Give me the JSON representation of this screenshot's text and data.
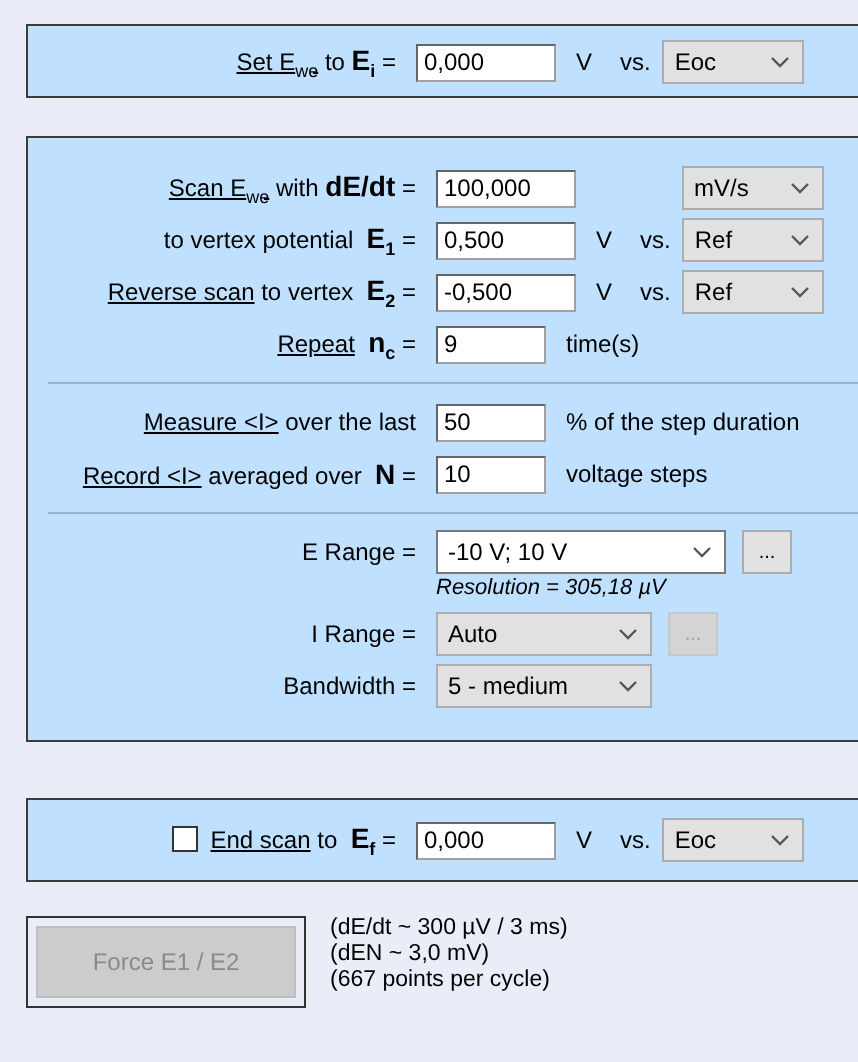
{
  "initial": {
    "kind": "potential",
    "link": "Set E$_{we}$",
    "label": " to **E**$_{i}$ =",
    "value": "0,000",
    "unit": "V",
    "vs": "vs.",
    "dropdown": "Eoc"
  },
  "scan": {
    "groups": [
      [
        {
          "kind": "rate",
          "link": "Scan E$_{we}$",
          "label": " with **dE/dt** =",
          "value": "100,000",
          "dropdown": "mV/s"
        },
        {
          "kind": "potential",
          "label": "to vertex potential  **E**$_{1}$ =",
          "value": "0,500",
          "unit": "V",
          "vs": "vs.",
          "dropdown": "Ref"
        },
        {
          "kind": "potential",
          "link": "Reverse scan",
          "label": " to vertex  **E**$_{2}$ =",
          "value": "-0,500",
          "unit": "V",
          "vs": "vs.",
          "dropdown": "Ref"
        },
        {
          "kind": "count",
          "link": "Repeat",
          "label": "  **n**$_{c}$ =",
          "value": "9",
          "unit": "time(s)"
        }
      ],
      [
        {
          "kind": "count",
          "link": "Measure <I>",
          "label": " over the last",
          "value": "50",
          "unit": "% of the step duration"
        },
        {
          "kind": "count",
          "link": "Record <I>",
          "label": " averaged over  **N** =",
          "value": "10",
          "unit": "voltage steps"
        }
      ],
      [
        {
          "kind": "select",
          "label": "E Range =",
          "dropdown": "-10 V; 10 V",
          "editable": true,
          "more": "...",
          "more_disabled": false,
          "note": "Resolution = 305,18 µV"
        },
        {
          "kind": "select",
          "label": "I Range =",
          "dropdown": "Auto",
          "editable": false,
          "more": "...",
          "more_disabled": true
        },
        {
          "kind": "select",
          "label": "Bandwidth =",
          "dropdown": "5 - medium",
          "editable": false
        }
      ]
    ]
  },
  "final": {
    "checked": false,
    "link": "End scan",
    "label": " to  **E**$_{f}$ =",
    "value": "0,000",
    "unit": "V",
    "vs": "vs.",
    "dropdown": "Eoc"
  },
  "force_button": {
    "label": "Force E1 / E2",
    "disabled": true
  },
  "notes": [
    "(dE/dt ~ 300 µV / 3 ms)",
    "(dEN ~ 3,0 mV)",
    "(667 points per cycle)"
  ]
}
